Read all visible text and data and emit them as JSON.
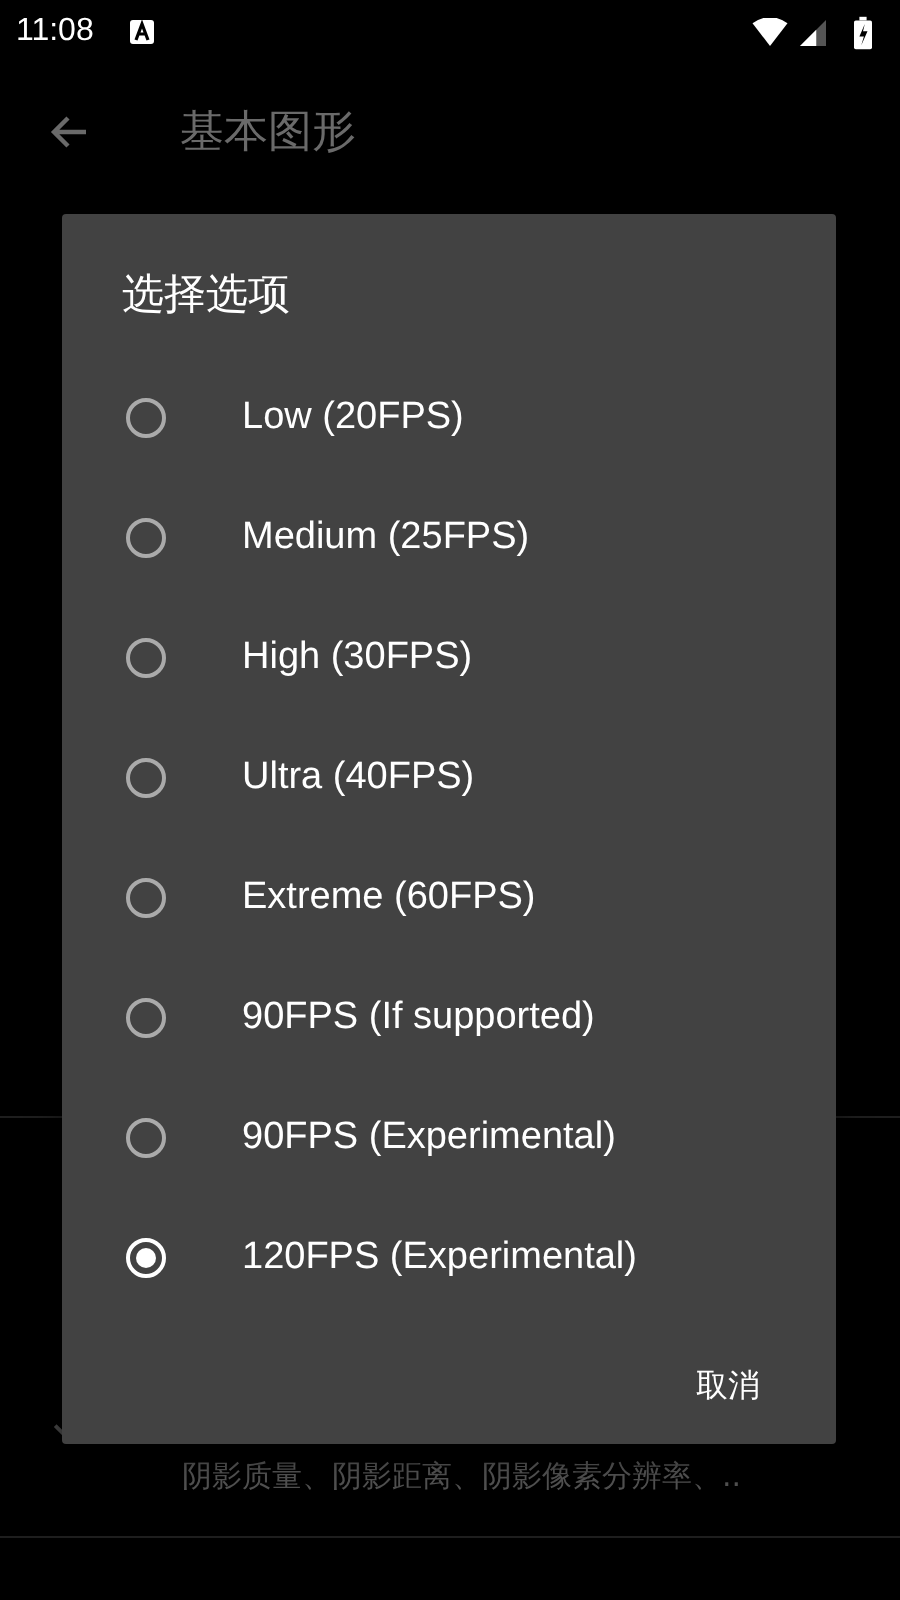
{
  "status_bar": {
    "time": "11:08"
  },
  "app_bar": {
    "title": "基本图形"
  },
  "background_item": {
    "subtitle": "阴影质量、阴影距离、阴影像素分辨率、.."
  },
  "dialog": {
    "title": "选择选项",
    "options": [
      {
        "label": "Low (20FPS)",
        "selected": false
      },
      {
        "label": "Medium (25FPS)",
        "selected": false
      },
      {
        "label": "High (30FPS)",
        "selected": false
      },
      {
        "label": "Ultra (40FPS)",
        "selected": false
      },
      {
        "label": "Extreme (60FPS)",
        "selected": false
      },
      {
        "label": "90FPS (If supported)",
        "selected": false
      },
      {
        "label": "90FPS (Experimental)",
        "selected": false
      },
      {
        "label": "120FPS (Experimental)",
        "selected": true
      }
    ],
    "cancel_button": "取消"
  }
}
